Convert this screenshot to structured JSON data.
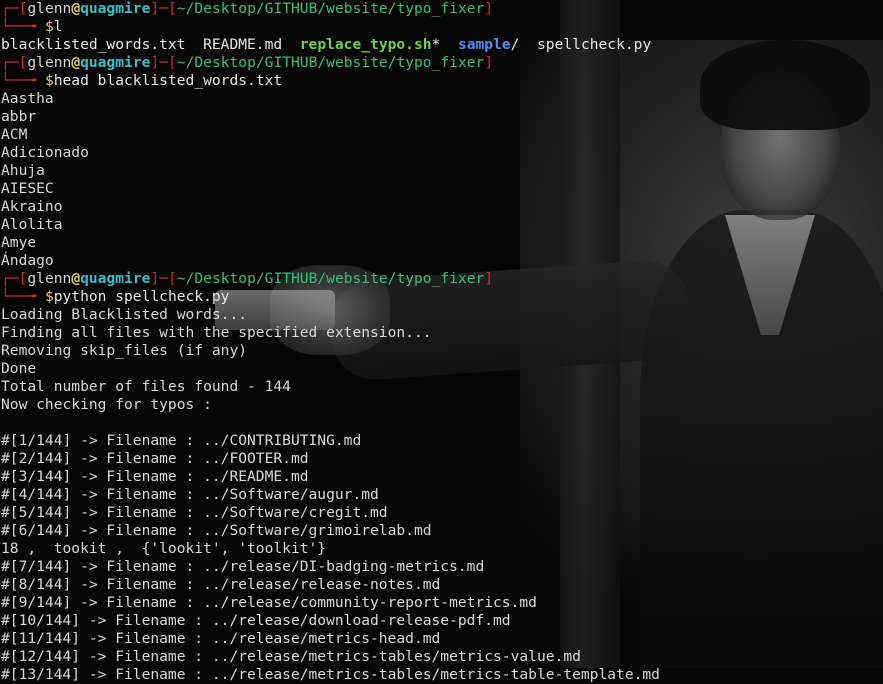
{
  "prompt": {
    "user": "glenn",
    "at": "@",
    "host": "quagmire",
    "path": "~/Desktop/GITHUB/website/typo_fixer",
    "symbol": "$"
  },
  "commands": {
    "ls": "l",
    "head": "head blacklisted_words.txt",
    "python": "python spellcheck.py"
  },
  "ls_output": [
    {
      "name": "blacklisted_words.txt",
      "suffix": "",
      "kind": "plain"
    },
    {
      "name": "README.md",
      "suffix": "",
      "kind": "plain"
    },
    {
      "name": "replace_typo.sh",
      "suffix": "*",
      "kind": "exec"
    },
    {
      "name": "sample",
      "suffix": "/",
      "kind": "dir"
    },
    {
      "name": "spellcheck.py",
      "suffix": "",
      "kind": "plain"
    }
  ],
  "head_output": [
    "Aastha",
    "abbr",
    "ACM",
    "Adicionado",
    "Ahuja",
    "AIESEC",
    "Akraino",
    "Alolita",
    "Amye",
    "Ándago"
  ],
  "python_output": [
    "Loading Blacklisted words...",
    "Finding all files with the specified extension...",
    "Removing skip_files (if any)",
    "Done",
    "Total number of files found - 144",
    "Now checking for typos :",
    "",
    "#[1/144] -> Filename : ../CONTRIBUTING.md",
    "#[2/144] -> Filename : ../FOOTER.md",
    "#[3/144] -> Filename : ../README.md",
    "#[4/144] -> Filename : ../Software/augur.md",
    "#[5/144] -> Filename : ../Software/cregit.md",
    "#[6/144] -> Filename : ../Software/grimoirelab.md",
    "18 ,  tookit ,  {'lookit', 'toolkit'}",
    "#[7/144] -> Filename : ../release/DI-badging-metrics.md",
    "#[8/144] -> Filename : ../release/release-notes.md",
    "#[9/144] -> Filename : ../release/community-report-metrics.md",
    "#[10/144] -> Filename : ../release/download-release-pdf.md",
    "#[11/144] -> Filename : ../release/metrics-head.md",
    "#[12/144] -> Filename : ../release/metrics-tables/metrics-value.md",
    "#[13/144] -> Filename : ../release/metrics-tables/metrics-table-template.md"
  ],
  "colors": {
    "prompt_frame": "#d0283a",
    "at": "#e4d34d",
    "host": "#34c2c9",
    "path": "#31c27a",
    "exec": "#6fd33a",
    "dir": "#4a8ff0"
  }
}
